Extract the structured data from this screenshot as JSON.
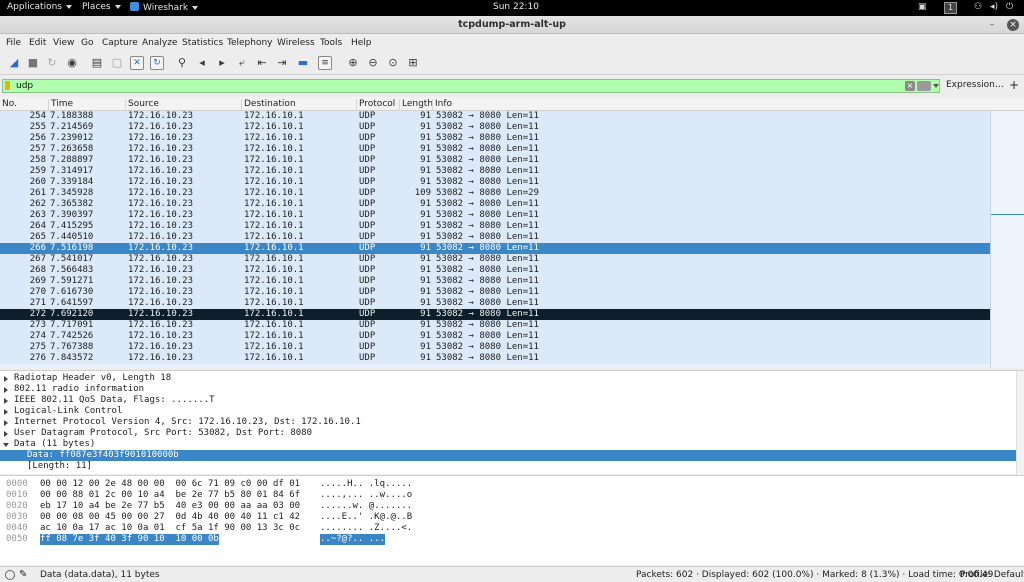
{
  "topbar": {
    "applications": "Applications",
    "places": "Places",
    "app_name": "Wireshark",
    "clock": "Sun 22:10",
    "workspace": "1"
  },
  "window": {
    "title": "tcpdump-arm-alt-up"
  },
  "menu": [
    "File",
    "Edit",
    "View",
    "Go",
    "Capture",
    "Analyze",
    "Statistics",
    "Telephony",
    "Wireless",
    "Tools",
    "Help"
  ],
  "filter": {
    "value": "udp",
    "expression_label": "Expression…",
    "plus_label": "+"
  },
  "columns": [
    "No.",
    "Time",
    "Source",
    "Destination",
    "Protocol",
    "Length",
    "Info"
  ],
  "packets": [
    {
      "no": "254",
      "time": "7.188388",
      "src": "172.16.10.23",
      "dst": "172.16.10.1",
      "proto": "UDP",
      "len": "91",
      "info": "53082 → 8080 Len=11"
    },
    {
      "no": "255",
      "time": "7.214569",
      "src": "172.16.10.23",
      "dst": "172.16.10.1",
      "proto": "UDP",
      "len": "91",
      "info": "53082 → 8080 Len=11"
    },
    {
      "no": "256",
      "time": "7.239012",
      "src": "172.16.10.23",
      "dst": "172.16.10.1",
      "proto": "UDP",
      "len": "91",
      "info": "53082 → 8080 Len=11"
    },
    {
      "no": "257",
      "time": "7.263658",
      "src": "172.16.10.23",
      "dst": "172.16.10.1",
      "proto": "UDP",
      "len": "91",
      "info": "53082 → 8080 Len=11"
    },
    {
      "no": "258",
      "time": "7.288897",
      "src": "172.16.10.23",
      "dst": "172.16.10.1",
      "proto": "UDP",
      "len": "91",
      "info": "53082 → 8080 Len=11"
    },
    {
      "no": "259",
      "time": "7.314917",
      "src": "172.16.10.23",
      "dst": "172.16.10.1",
      "proto": "UDP",
      "len": "91",
      "info": "53082 → 8080 Len=11"
    },
    {
      "no": "260",
      "time": "7.339184",
      "src": "172.16.10.23",
      "dst": "172.16.10.1",
      "proto": "UDP",
      "len": "91",
      "info": "53082 → 8080 Len=11"
    },
    {
      "no": "261",
      "time": "7.345928",
      "src": "172.16.10.23",
      "dst": "172.16.10.1",
      "proto": "UDP",
      "len": "109",
      "info": "53082 → 8080 Len=29"
    },
    {
      "no": "262",
      "time": "7.365382",
      "src": "172.16.10.23",
      "dst": "172.16.10.1",
      "proto": "UDP",
      "len": "91",
      "info": "53082 → 8080 Len=11"
    },
    {
      "no": "263",
      "time": "7.390397",
      "src": "172.16.10.23",
      "dst": "172.16.10.1",
      "proto": "UDP",
      "len": "91",
      "info": "53082 → 8080 Len=11"
    },
    {
      "no": "264",
      "time": "7.415295",
      "src": "172.16.10.23",
      "dst": "172.16.10.1",
      "proto": "UDP",
      "len": "91",
      "info": "53082 → 8080 Len=11"
    },
    {
      "no": "265",
      "time": "7.440510",
      "src": "172.16.10.23",
      "dst": "172.16.10.1",
      "proto": "UDP",
      "len": "91",
      "info": "53082 → 8080 Len=11"
    },
    {
      "no": "266",
      "time": "7.516198",
      "src": "172.16.10.23",
      "dst": "172.16.10.1",
      "proto": "UDP",
      "len": "91",
      "info": "53082 → 8080 Len=11"
    },
    {
      "no": "267",
      "time": "7.541017",
      "src": "172.16.10.23",
      "dst": "172.16.10.1",
      "proto": "UDP",
      "len": "91",
      "info": "53082 → 8080 Len=11"
    },
    {
      "no": "268",
      "time": "7.566483",
      "src": "172.16.10.23",
      "dst": "172.16.10.1",
      "proto": "UDP",
      "len": "91",
      "info": "53082 → 8080 Len=11"
    },
    {
      "no": "269",
      "time": "7.591271",
      "src": "172.16.10.23",
      "dst": "172.16.10.1",
      "proto": "UDP",
      "len": "91",
      "info": "53082 → 8080 Len=11"
    },
    {
      "no": "270",
      "time": "7.616730",
      "src": "172.16.10.23",
      "dst": "172.16.10.1",
      "proto": "UDP",
      "len": "91",
      "info": "53082 → 8080 Len=11"
    },
    {
      "no": "271",
      "time": "7.641597",
      "src": "172.16.10.23",
      "dst": "172.16.10.1",
      "proto": "UDP",
      "len": "91",
      "info": "53082 → 8080 Len=11"
    },
    {
      "no": "272",
      "time": "7.692120",
      "src": "172.16.10.23",
      "dst": "172.16.10.1",
      "proto": "UDP",
      "len": "91",
      "info": "53082 → 8080 Len=11"
    },
    {
      "no": "273",
      "time": "7.717091",
      "src": "172.16.10.23",
      "dst": "172.16.10.1",
      "proto": "UDP",
      "len": "91",
      "info": "53082 → 8080 Len=11"
    },
    {
      "no": "274",
      "time": "7.742526",
      "src": "172.16.10.23",
      "dst": "172.16.10.1",
      "proto": "UDP",
      "len": "91",
      "info": "53082 → 8080 Len=11"
    },
    {
      "no": "275",
      "time": "7.767388",
      "src": "172.16.10.23",
      "dst": "172.16.10.1",
      "proto": "UDP",
      "len": "91",
      "info": "53082 → 8080 Len=11"
    },
    {
      "no": "276",
      "time": "7.843572",
      "src": "172.16.10.23",
      "dst": "172.16.10.1",
      "proto": "UDP",
      "len": "91",
      "info": "53082 → 8080 Len=11"
    }
  ],
  "selected_packet": "266",
  "marked_packet": "272",
  "details": [
    {
      "text": "Radiotap Header v0, Length 18",
      "state": "collapsed",
      "indent": 0
    },
    {
      "text": "802.11 radio information",
      "state": "collapsed",
      "indent": 0
    },
    {
      "text": "IEEE 802.11 QoS Data, Flags: .......T",
      "state": "collapsed",
      "indent": 0
    },
    {
      "text": "Logical-Link Control",
      "state": "collapsed",
      "indent": 0
    },
    {
      "text": "Internet Protocol Version 4, Src: 172.16.10.23, Dst: 172.16.10.1",
      "state": "collapsed",
      "indent": 0
    },
    {
      "text": "User Datagram Protocol, Src Port: 53082, Dst Port: 8080",
      "state": "collapsed",
      "indent": 0
    },
    {
      "text": "Data (11 bytes)",
      "state": "expanded",
      "indent": 0
    },
    {
      "text": "Data: ff087e3f403f901010000b",
      "state": "leaf",
      "indent": 1,
      "selected": true
    },
    {
      "text": "[Length: 11]",
      "state": "leaf",
      "indent": 1
    }
  ],
  "bytes": [
    {
      "offset": "0000",
      "hex": "00 00 12 00 2e 48 00 00  00 6c 71 09 c0 00 df 01",
      "ascii": ".....H.. .lq....."
    },
    {
      "offset": "0010",
      "hex": "00 00 88 01 2c 00 10 a4  be 2e 77 b5 80 01 84 6f",
      "ascii": "....,... ..w....o"
    },
    {
      "offset": "0020",
      "hex": "eb 17 10 a4 be 2e 77 b5  40 e3 00 00 aa aa 03 00",
      "ascii": "......w. @......."
    },
    {
      "offset": "0030",
      "hex": "00 00 08 00 45 00 00 27  0d 4b 40 00 40 11 c1 42",
      "ascii": "....E..' .K@.@..B"
    },
    {
      "offset": "0040",
      "hex": "ac 10 0a 17 ac 10 0a 01  cf 5a 1f 90 00 13 3c 0c",
      "ascii": "........ .Z....<."
    },
    {
      "offset": "0050",
      "hex": "ff 08 7e 3f 40 3f 90 10  10 00 0b",
      "ascii": "..~?@?.. ..."
    }
  ],
  "status": {
    "field": "Data (data.data), 11 bytes",
    "packets": "Packets: 602 · Displayed: 602 (100.0%) · Marked: 8 (1.3%) · Load time: 0:00.49",
    "profile": "Profile: Default"
  },
  "colors": {
    "filter_ok": "#afffaf",
    "row_bg": "#dbe9f8",
    "selected": "#3b86c6",
    "marked": "#0e1e2a"
  }
}
